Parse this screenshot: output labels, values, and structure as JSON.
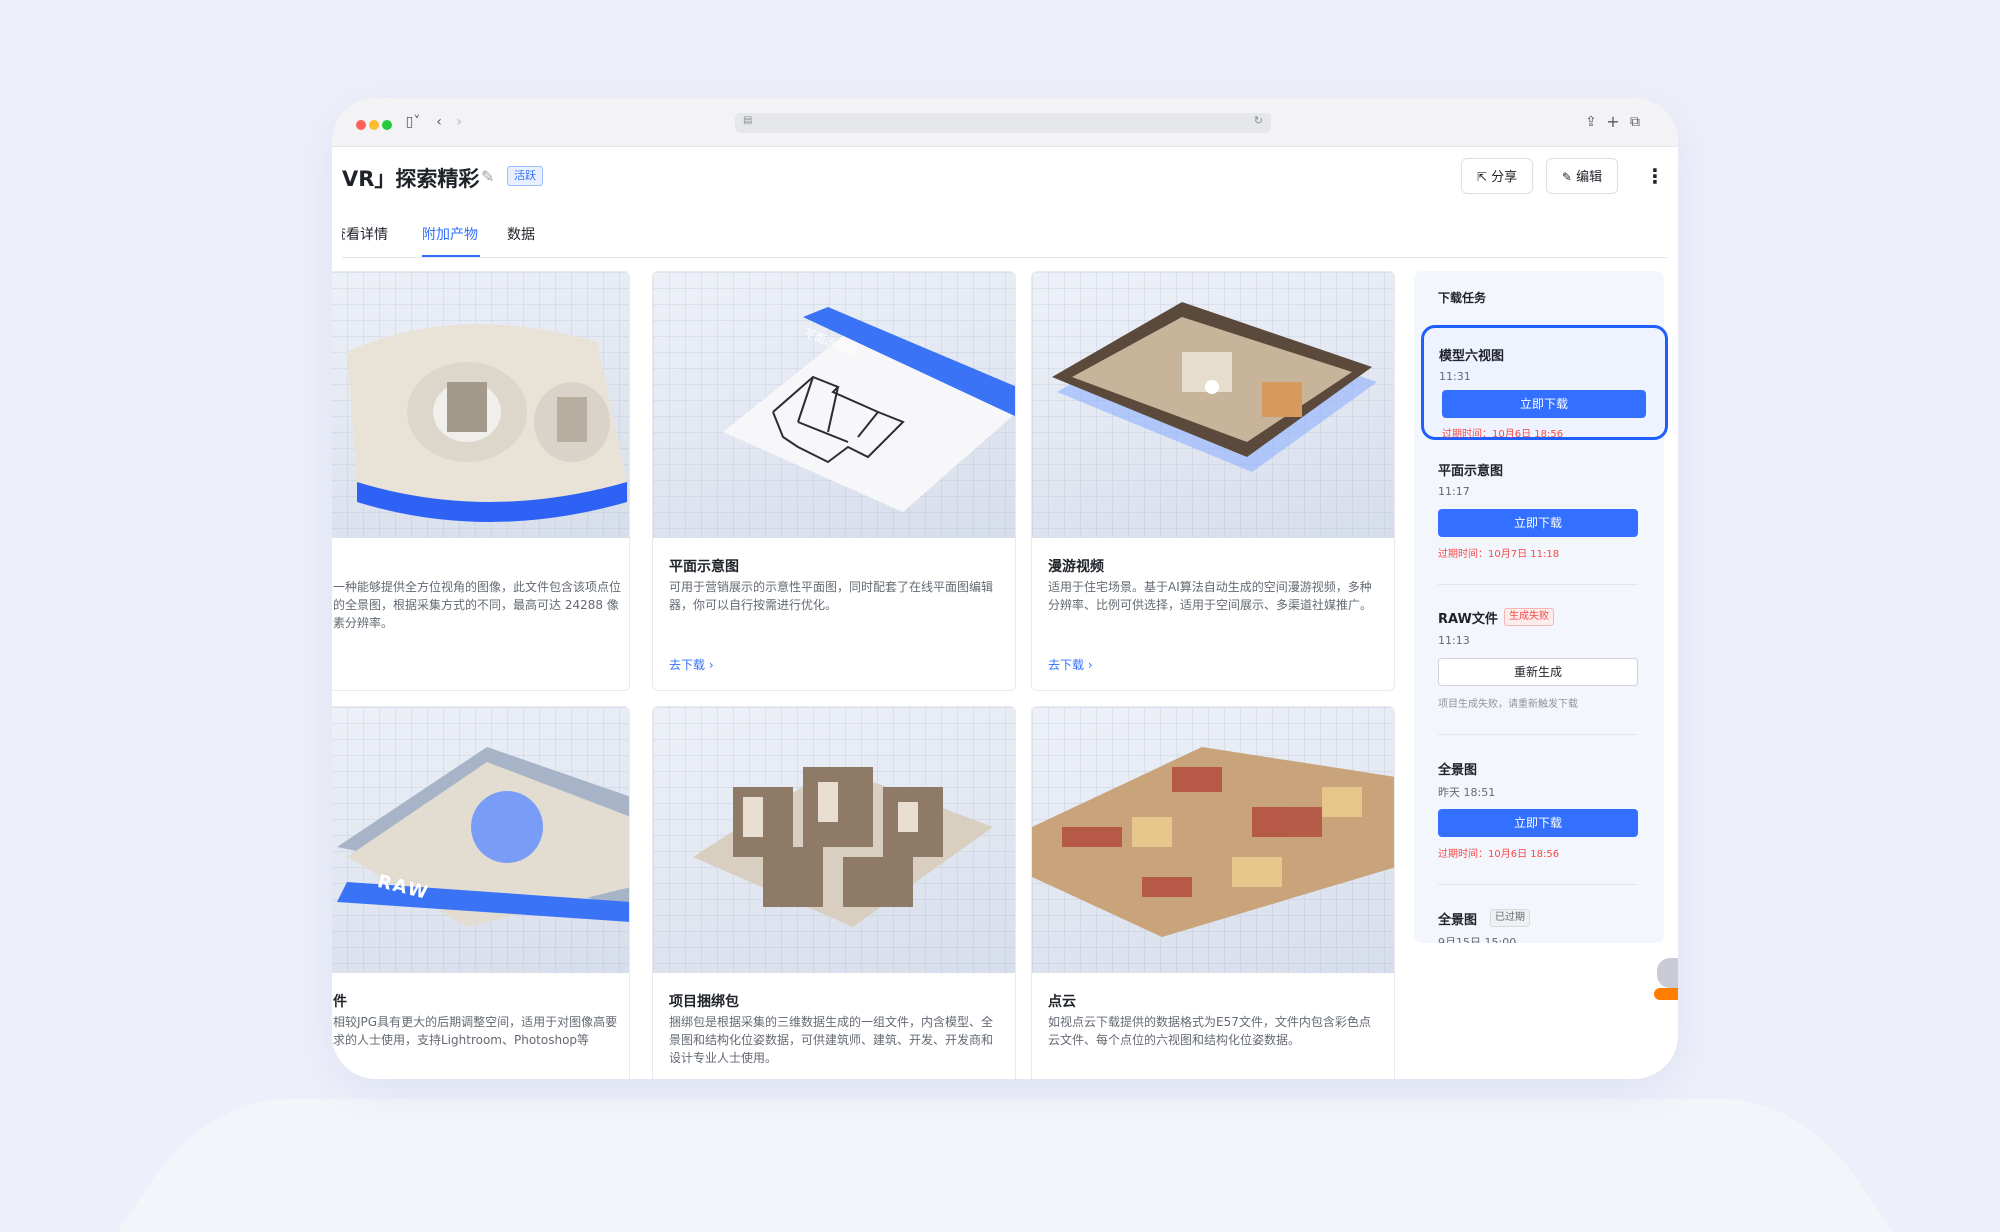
{
  "page": {
    "title": "VR」探索精彩",
    "status_tag": "活跃",
    "share_label": "分享",
    "edit_label": "编辑"
  },
  "tabs": [
    {
      "label": "查看详情",
      "visible_label": "查看详情"
    },
    {
      "label": "附加产物"
    },
    {
      "label": "数据"
    }
  ],
  "cards": [
    {
      "title": "",
      "desc": "一种能够提供全方位视角的图像，此文件包含该项点位的全景图，根据采集方式的不同，最高可达 24288 像素分辨率。",
      "link": ""
    },
    {
      "title": "平面示意图",
      "desc": "可用于营销展示的示意性平面图，同时配套了在线平面图编辑器，你可以自行按需进行优化。",
      "link": "去下载",
      "image_label": "平面示意图"
    },
    {
      "title": "漫游视频",
      "desc": "适用于住宅场景。基于AI算法自动生成的空间漫游视频，多种分辨率、比例可供选择，适用于空间展示、多渠道社媒推广。",
      "link": "去下载"
    },
    {
      "title": "件",
      "desc": "相较JPG具有更大的后期调整空间，适用于对图像高要求的人士使用，支持Lightroom、Photoshop等",
      "link": "",
      "image_label": "RAW"
    },
    {
      "title": "项目捆绑包",
      "desc": "捆绑包是根据采集的三维数据生成的一组文件，内含模型、全景图和结构化位姿数据，可供建筑师、建筑、开发、开发商和设计专业人士使用。",
      "link": ""
    },
    {
      "title": "点云",
      "desc": "如视点云下载提供的数据格式为E57文件，文件内包含彩色点云文件、每个点位的六视图和结构化位姿数据。",
      "link": ""
    }
  ],
  "download_panel": {
    "title": "下载任务",
    "tasks": [
      {
        "name": "模型六视图",
        "time": "11:31",
        "button": "立即下载",
        "expire": "过期时间：10月6日 18:56"
      },
      {
        "name": "平面示意图",
        "time": "11:17",
        "button": "立即下载",
        "expire": "过期时间：10月7日 11:18"
      },
      {
        "name": "RAW文件",
        "tag": "生成失败",
        "time": "11:13",
        "button": "重新生成",
        "hint": "项目生成失败，请重新触发下载"
      },
      {
        "name": "全景图",
        "time": "昨天 18:51",
        "button": "立即下载",
        "expire": "过期时间：10月6日 18:56"
      },
      {
        "name": "全景图",
        "tag": "已过期",
        "time": "9月15日 15:00"
      }
    ]
  },
  "colors": {
    "accent": "#3370ff",
    "highlight": "#1f5fff",
    "error": "#f54a45",
    "background": "#edf0fa"
  },
  "icons": {
    "share": "share-icon",
    "edit": "edit-icon",
    "more": "more-vertical-icon",
    "chevron": "chevron-right-icon"
  }
}
